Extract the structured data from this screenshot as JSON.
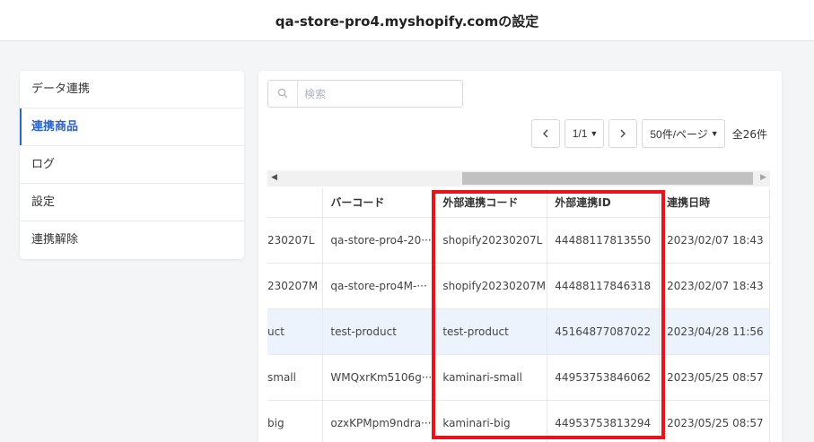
{
  "header": {
    "title": "qa-store-pro4.myshopify.comの設定"
  },
  "sidebar": {
    "items": [
      {
        "label": "データ連携"
      },
      {
        "label": "連携商品"
      },
      {
        "label": "ログ"
      },
      {
        "label": "設定"
      },
      {
        "label": "連携解除"
      }
    ],
    "active_index": 1
  },
  "search": {
    "placeholder": "検索",
    "value": ""
  },
  "pagination": {
    "page": "1/1",
    "per_page": "50件/ページ",
    "total": "全26件"
  },
  "table": {
    "columns": [
      "",
      "バーコード",
      "外部連携コード",
      "外部連携ID",
      "連携日時"
    ],
    "rows": [
      [
        "230207L",
        "qa-store-pro4-20···",
        "shopify20230207L",
        "44488117813550",
        "2023/02/07 18:43"
      ],
      [
        "230207M",
        "qa-store-pro4M-···",
        "shopify20230207M",
        "44488117846318",
        "2023/02/07 18:43"
      ],
      [
        "uct",
        "test-product",
        "test-product",
        "45164877087022",
        "2023/04/28 11:56"
      ],
      [
        "small",
        "WMQxrKm5106g···",
        "kaminari-small",
        "44953753846062",
        "2023/05/25 08:57"
      ],
      [
        "big",
        "ozxKPMpm9ndra···",
        "kaminari-big",
        "44953753813294",
        "2023/05/25 08:57"
      ]
    ],
    "highlighted_row": 2
  },
  "colors": {
    "accent": "#2a63c9",
    "highlight_row": "#edf3fc",
    "annotation_box": "#e8141c"
  }
}
